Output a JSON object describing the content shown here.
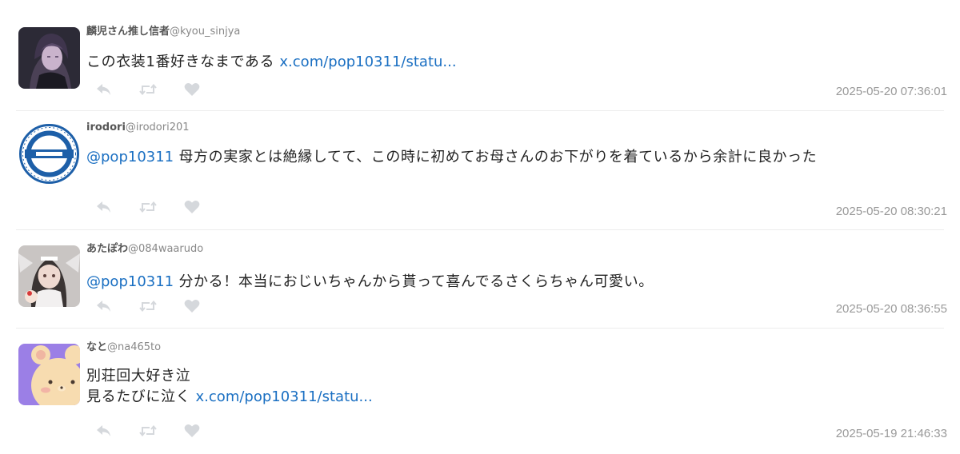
{
  "tweets": [
    {
      "name": "麟児さん推し信者",
      "handle": "@kyou_sinjya",
      "avatar_icon": "dark-haired-character-avatar",
      "lines": [
        {
          "text": "この衣装1番好きなまである ",
          "link": "x.com/pop10311/statu..."
        }
      ],
      "timestamp": "2025-05-20 07:36:01"
    },
    {
      "name": "irodori",
      "handle": "@irodori201",
      "avatar_icon": "blue-emblem-avatar",
      "lines": [
        {
          "mention": "@pop10311",
          "text": " 母方の実家とは絶縁してて、この時に初めてお母さんのお下がりを着ているから余計に良かった"
        }
      ],
      "timestamp": "2025-05-20 08:30:21"
    },
    {
      "name": "あたぽわ",
      "handle": "@084waarudo",
      "avatar_icon": "maid-character-avatar",
      "lines": [
        {
          "mention": "@pop10311",
          "text": " 分かる！本当におじいちゃんから貰って喜んでるさくらちゃん可愛い。"
        }
      ],
      "timestamp": "2025-05-20 08:36:55"
    },
    {
      "name": "なと",
      "handle": "@na465to",
      "avatar_icon": "bear-face-avatar",
      "lines": [
        {
          "text": "別荘回大好き泣"
        },
        {
          "text": "見るたびに泣く ",
          "link": "x.com/pop10311/statu..."
        }
      ],
      "timestamp": "2025-05-19 21:46:33"
    }
  ],
  "actions": {
    "reply_icon": "reply-icon",
    "retweet_icon": "retweet-icon",
    "like_icon": "heart-icon"
  },
  "colors": {
    "link": "#1a6fc2",
    "icon": "#d5d8dc",
    "timestamp": "#999999"
  }
}
